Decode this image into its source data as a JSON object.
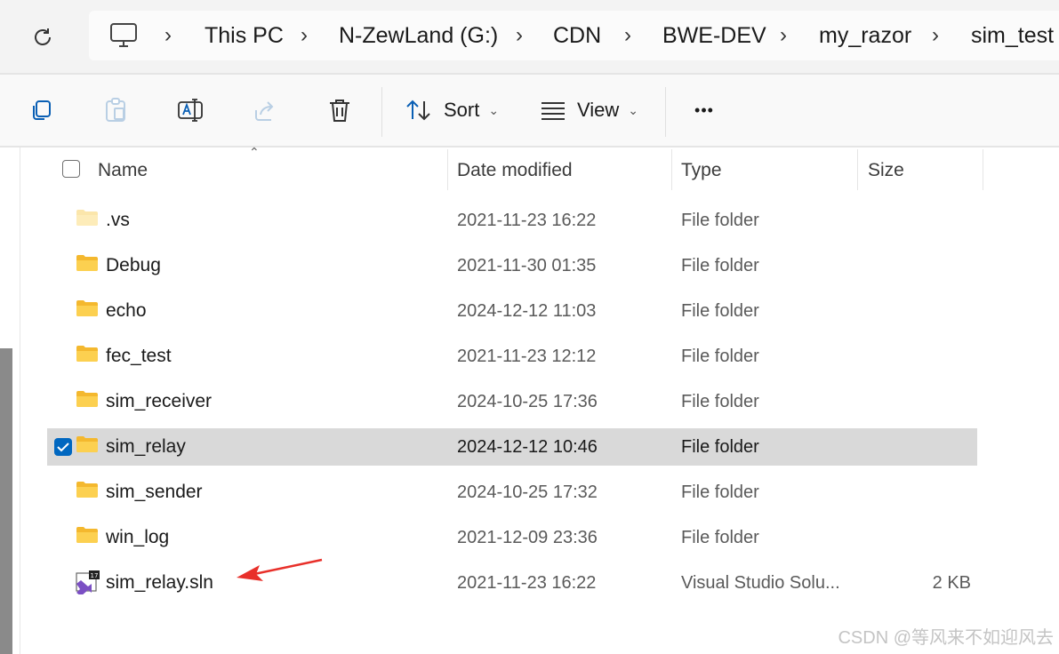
{
  "address_bar": {
    "crumbs": [
      "This PC",
      "N-ZewLand (G:)",
      "CDN",
      "BWE-DEV",
      "my_razor",
      "sim_test"
    ]
  },
  "toolbar": {
    "sort_label": "Sort",
    "view_label": "View",
    "more_label": "•••"
  },
  "columns": {
    "name": "Name",
    "date": "Date modified",
    "type": "Type",
    "size": "Size"
  },
  "files": [
    {
      "name": ".vs",
      "date": "2021-11-23 16:22",
      "type": "File folder",
      "size": "",
      "icon": "folder-icon-faded"
    },
    {
      "name": "Debug",
      "date": "2021-11-30 01:35",
      "type": "File folder",
      "size": "",
      "icon": "folder-icon"
    },
    {
      "name": "echo",
      "date": "2024-12-12 11:03",
      "type": "File folder",
      "size": "",
      "icon": "folder-icon"
    },
    {
      "name": "fec_test",
      "date": "2021-11-23 12:12",
      "type": "File folder",
      "size": "",
      "icon": "folder-icon"
    },
    {
      "name": "sim_receiver",
      "date": "2024-10-25 17:36",
      "type": "File folder",
      "size": "",
      "icon": "folder-icon"
    },
    {
      "name": "sim_relay",
      "date": "2024-12-12 10:46",
      "type": "File folder",
      "size": "",
      "icon": "folder-icon",
      "selected": true
    },
    {
      "name": "sim_sender",
      "date": "2024-10-25 17:32",
      "type": "File folder",
      "size": "",
      "icon": "folder-icon"
    },
    {
      "name": "win_log",
      "date": "2021-12-09 23:36",
      "type": "File folder",
      "size": "",
      "icon": "folder-icon"
    },
    {
      "name": "sim_relay.sln",
      "date": "2021-11-23 16:22",
      "type": "Visual Studio Solu...",
      "size": "2 KB",
      "icon": "visual-studio-solution-icon"
    }
  ],
  "vs_badge": "17",
  "watermark": "CSDN @等风来不如迎风去",
  "colors": {
    "accent": "#0067c0",
    "selected_row": "#d9d9d9",
    "folder": "#f8c846",
    "annotation_arrow": "#e8302a"
  }
}
